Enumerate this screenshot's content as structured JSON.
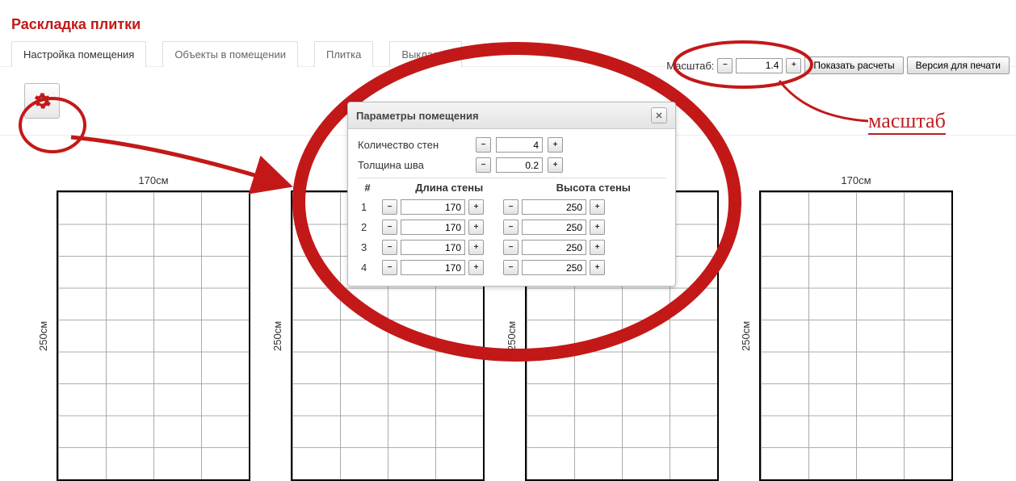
{
  "title": "Раскладка плитки",
  "tabs": [
    {
      "label": "Настройка помещения",
      "active": true
    },
    {
      "label": "Объекты в помещении",
      "active": false
    },
    {
      "label": "Плитка",
      "active": false
    },
    {
      "label": "Выкладка",
      "active": false
    }
  ],
  "scale": {
    "label": "Масштаб:",
    "value": "1.4"
  },
  "actions": {
    "show_calc": "Показать расчеты",
    "print_version": "Версия для печати"
  },
  "dialog": {
    "title": "Параметры помещения",
    "walls_count_label": "Количество стен",
    "walls_count_value": "4",
    "seam_label": "Толщина шва",
    "seam_value": "0.2",
    "col_num": "#",
    "col_len": "Длина стены",
    "col_hgt": "Высота стены",
    "rows": [
      {
        "n": "1",
        "len": "170",
        "hgt": "250"
      },
      {
        "n": "2",
        "len": "170",
        "hgt": "250"
      },
      {
        "n": "3",
        "len": "170",
        "hgt": "250"
      },
      {
        "n": "4",
        "len": "170",
        "hgt": "250"
      }
    ]
  },
  "walls_display": {
    "width_label": "170см",
    "height_label": "250см"
  },
  "annotation": {
    "scale_word": "масштаб"
  },
  "glyph": {
    "plus": "+",
    "minus": "−",
    "close": "✕"
  }
}
